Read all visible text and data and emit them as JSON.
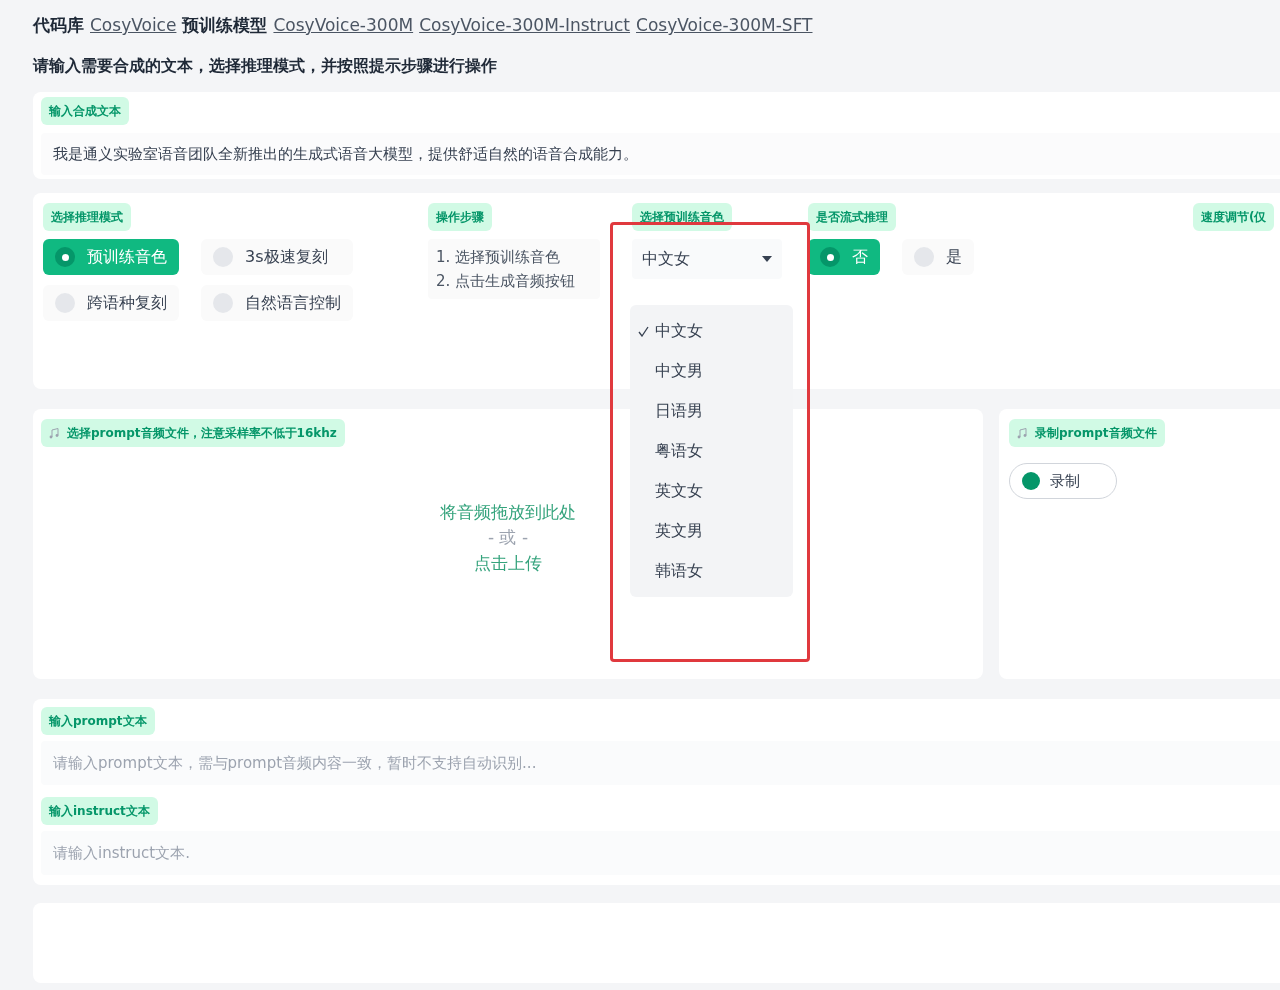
{
  "header": {
    "segments": [
      {
        "kind": "text",
        "text": "代码库"
      },
      {
        "kind": "link",
        "text": "CosyVoice"
      },
      {
        "kind": "text",
        "text": "预训练模型"
      },
      {
        "kind": "link",
        "text": "CosyVoice-300M"
      },
      {
        "kind": "link",
        "text": "CosyVoice-300M-Instruct"
      },
      {
        "kind": "link",
        "text": "CosyVoice-300M-SFT"
      }
    ],
    "subtitle": "请输入需要合成的文本，选择推理模式，并按照提示步骤进行操作"
  },
  "synthesis_text": {
    "label": "输入合成文本",
    "value": "我是通义实验室语音团队全新推出的生成式语音大模型，提供舒适自然的语音合成能力。"
  },
  "mode": {
    "label": "选择推理模式",
    "options": [
      {
        "label": "预训练音色",
        "selected": true
      },
      {
        "label": "3s极速复刻",
        "selected": false
      },
      {
        "label": "跨语种复刻",
        "selected": false
      },
      {
        "label": "自然语言控制",
        "selected": false
      }
    ]
  },
  "steps": {
    "label": "操作步骤",
    "lines": [
      "1. 选择预训练音色",
      "2. 点击生成音频按钮"
    ]
  },
  "voice": {
    "label": "选择预训练音色",
    "value": "中文女",
    "expanded": true,
    "highlighted": true,
    "options": [
      {
        "label": "中文女",
        "selected": true
      },
      {
        "label": "中文男",
        "selected": false
      },
      {
        "label": "日语男",
        "selected": false
      },
      {
        "label": "粤语女",
        "selected": false
      },
      {
        "label": "英文女",
        "selected": false
      },
      {
        "label": "英文男",
        "selected": false
      },
      {
        "label": "韩语女",
        "selected": false
      }
    ]
  },
  "stream": {
    "label": "是否流式推理",
    "options": [
      {
        "label": "否",
        "selected": true
      },
      {
        "label": "是",
        "selected": false
      }
    ]
  },
  "speed": {
    "label": "速度调节(仅"
  },
  "upload": {
    "label": "选择prompt音频文件，注意采样率不低于16khz",
    "drop_text": "将音频拖放到此处",
    "or_text": "- 或 -",
    "click_text": "点击上传"
  },
  "record": {
    "label": "录制prompt音频文件",
    "button": "录制"
  },
  "prompt_text": {
    "label": "输入prompt文本",
    "placeholder": "请输入prompt文本，需与prompt音频内容一致，暂时不支持自动识别..."
  },
  "instruct_text": {
    "label": "输入instruct文本",
    "placeholder": "请输入instruct文本."
  }
}
